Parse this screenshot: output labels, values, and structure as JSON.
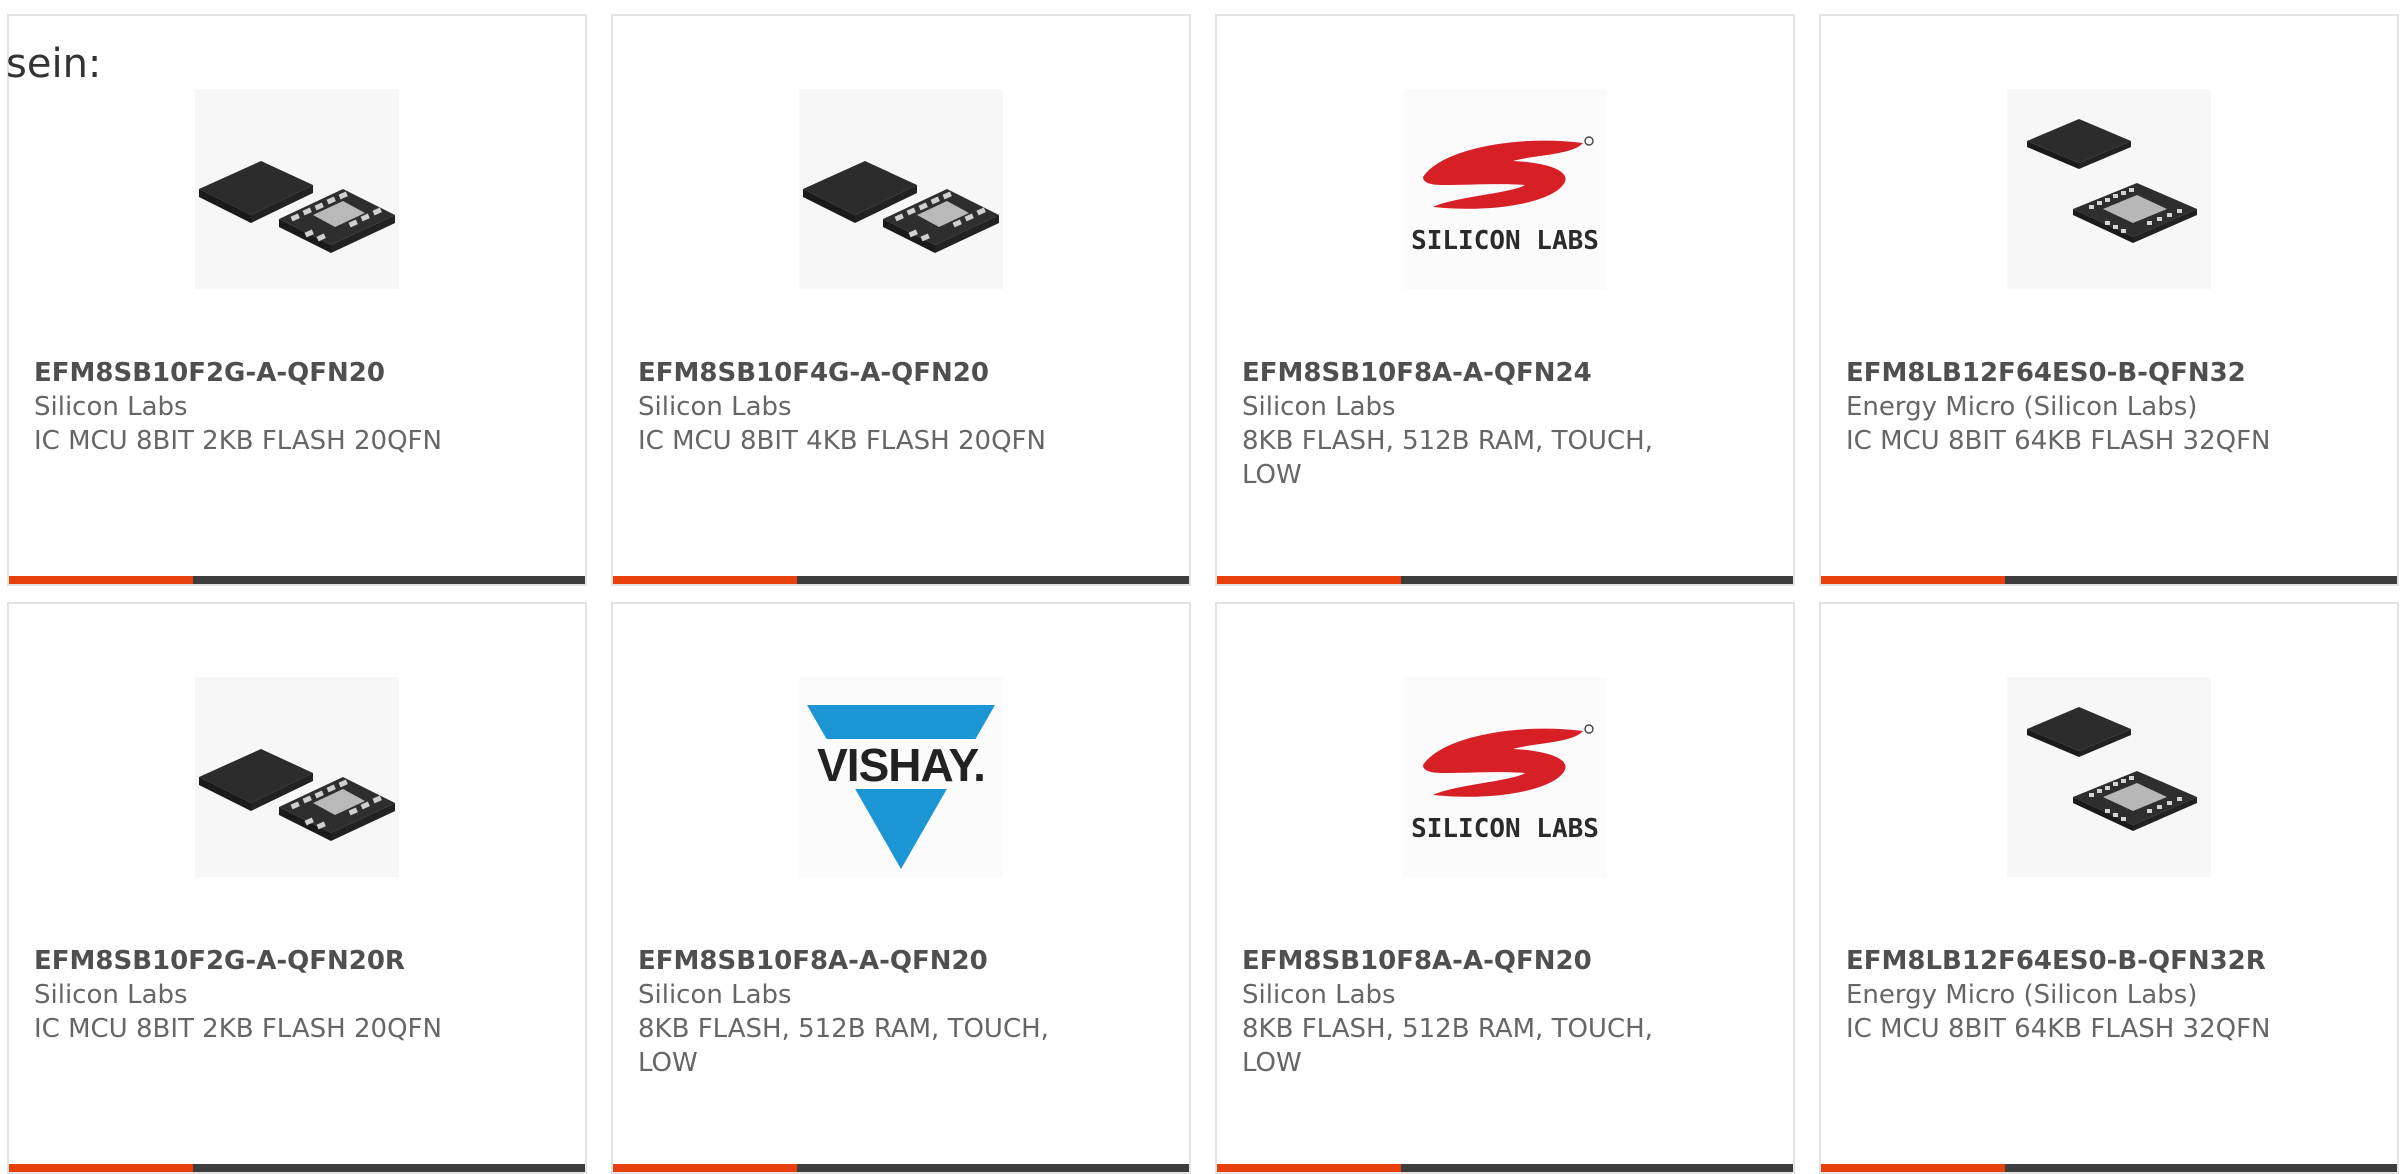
{
  "intro_text": "sein:",
  "colors": {
    "accent": "#e8400c",
    "bar_dark": "#3d3d3d",
    "card_border": "#e3e3e3",
    "silicon_labs_red": "#d71f26",
    "vishay_blue": "#1b95d3"
  },
  "accent_fraction": 0.32,
  "products": [
    {
      "part": "EFM8SB10F2G-A-QFN20",
      "manufacturer": "Silicon Labs",
      "description": "IC MCU 8BIT 2KB FLASH 20QFN",
      "image": "qfn20-chip-icon"
    },
    {
      "part": "EFM8SB10F4G-A-QFN20",
      "manufacturer": "Silicon Labs",
      "description": "IC MCU 8BIT 4KB FLASH 20QFN",
      "image": "qfn20-chip-icon"
    },
    {
      "part": "EFM8SB10F8A-A-QFN24",
      "manufacturer": "Silicon Labs",
      "description": "8KB FLASH, 512B RAM, TOUCH, LOW",
      "image": "silicon-labs-logo",
      "logo_text": "SILICON LABS"
    },
    {
      "part": "EFM8LB12F64ES0-B-QFN32",
      "manufacturer": "Energy Micro (Silicon Labs)",
      "description": "IC MCU 8BIT 64KB FLASH 32QFN",
      "image": "qfn32-chip-icon"
    },
    {
      "part": "EFM8SB10F2G-A-QFN20R",
      "manufacturer": "Silicon Labs",
      "description": "IC MCU 8BIT 2KB FLASH 20QFN",
      "image": "qfn20-chip-icon"
    },
    {
      "part": "EFM8SB10F8A-A-QFN20",
      "manufacturer": "Silicon Labs",
      "description": "8KB FLASH, 512B RAM, TOUCH, LOW",
      "image": "vishay-logo",
      "logo_text": "VISHAY."
    },
    {
      "part": "EFM8SB10F8A-A-QFN20",
      "manufacturer": "Silicon Labs",
      "description": "8KB FLASH, 512B RAM, TOUCH, LOW",
      "image": "silicon-labs-logo",
      "logo_text": "SILICON LABS"
    },
    {
      "part": "EFM8LB12F64ES0-B-QFN32R",
      "manufacturer": "Energy Micro (Silicon Labs)",
      "description": "IC MCU 8BIT 64KB FLASH 32QFN",
      "image": "qfn32-chip-icon"
    }
  ]
}
